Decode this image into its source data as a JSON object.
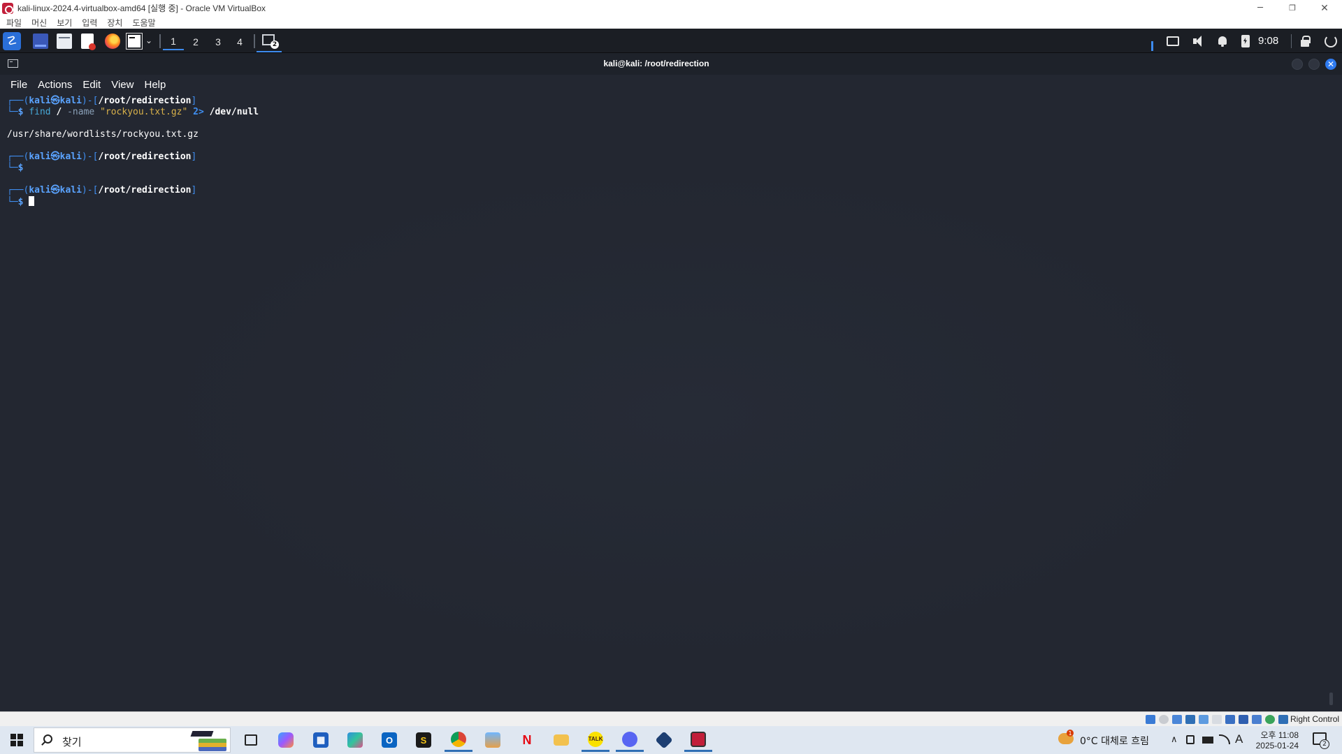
{
  "vbox": {
    "title": "kali-linux-2024.4-virtualbox-amd64 [실행 중] - Oracle VM VirtualBox",
    "menu": [
      "파일",
      "머신",
      "보기",
      "입력",
      "장치",
      "도움말"
    ],
    "window_controls": {
      "minimize": "─",
      "restore": "❐",
      "close": "✕"
    },
    "host_key_label": "Right Control"
  },
  "xfce_panel": {
    "workspaces": [
      "1",
      "2",
      "3",
      "4"
    ],
    "active_workspace": "1",
    "taskbar_window_badge": "2",
    "clock": "9:08",
    "icons": [
      "kali-menu-icon",
      "show-desktop-icon",
      "file-manager-icon",
      "text-editor-icon",
      "firefox-icon",
      "terminal-icon",
      "display-icon",
      "volume-icon",
      "notification-icon",
      "power-icon",
      "lock-icon",
      "logout-icon"
    ]
  },
  "terminal": {
    "title": "kali@kali: /root/redirection",
    "menu": [
      "File",
      "Actions",
      "Edit",
      "View",
      "Help"
    ],
    "prompt": {
      "user": "kali",
      "at": "㉿",
      "host": "kali",
      "path": "/root/redirection",
      "symbol": "$"
    },
    "command": {
      "cmd": "find",
      "arg1": "/",
      "opt": "-name",
      "pattern": "\"rockyou.txt.gz\"",
      "redirect": "2>",
      "target": "/dev/null"
    },
    "output": "/usr/share/wordlists/rockyou.txt.gz"
  },
  "windows_taskbar": {
    "search_placeholder": "찾기",
    "apps": [
      "task-view",
      "copilot",
      "microsoft-store",
      "microsoft-365",
      "outlook",
      "s-app",
      "chrome",
      "photos",
      "netflix",
      "file-explorer",
      "kakaotalk",
      "discord",
      "virtualbox",
      "kali-vm"
    ],
    "weather": "0°C  대체로 흐림",
    "weather_badge": "1",
    "ime_indicator": "A",
    "time": "오후 11:08",
    "date": "2025-01-24",
    "notification_count": "2"
  }
}
